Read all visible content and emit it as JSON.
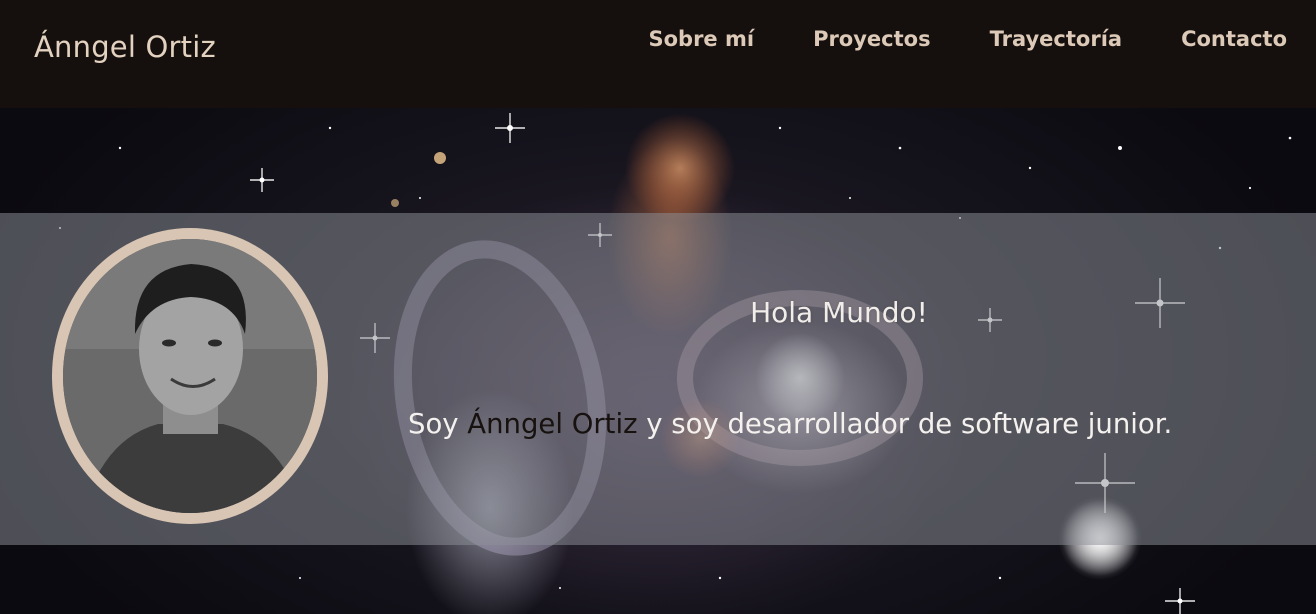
{
  "header": {
    "brand": "Ánngel Ortiz",
    "nav": [
      "Sobre mí",
      "Proyectos",
      "Trayectoría",
      "Contacto"
    ]
  },
  "hero": {
    "greeting": "Hola Mundo!",
    "intro_prefix": "Soy ",
    "intro_name": "Ánngel Ortiz",
    "intro_suffix": " y soy desarrollador de software junior."
  },
  "colors": {
    "header_bg": "#15100d",
    "nav_text": "#dcc9b7",
    "avatar_ring": "#d8c5b4",
    "band_overlay": "rgba(140,144,152,0.52)"
  }
}
